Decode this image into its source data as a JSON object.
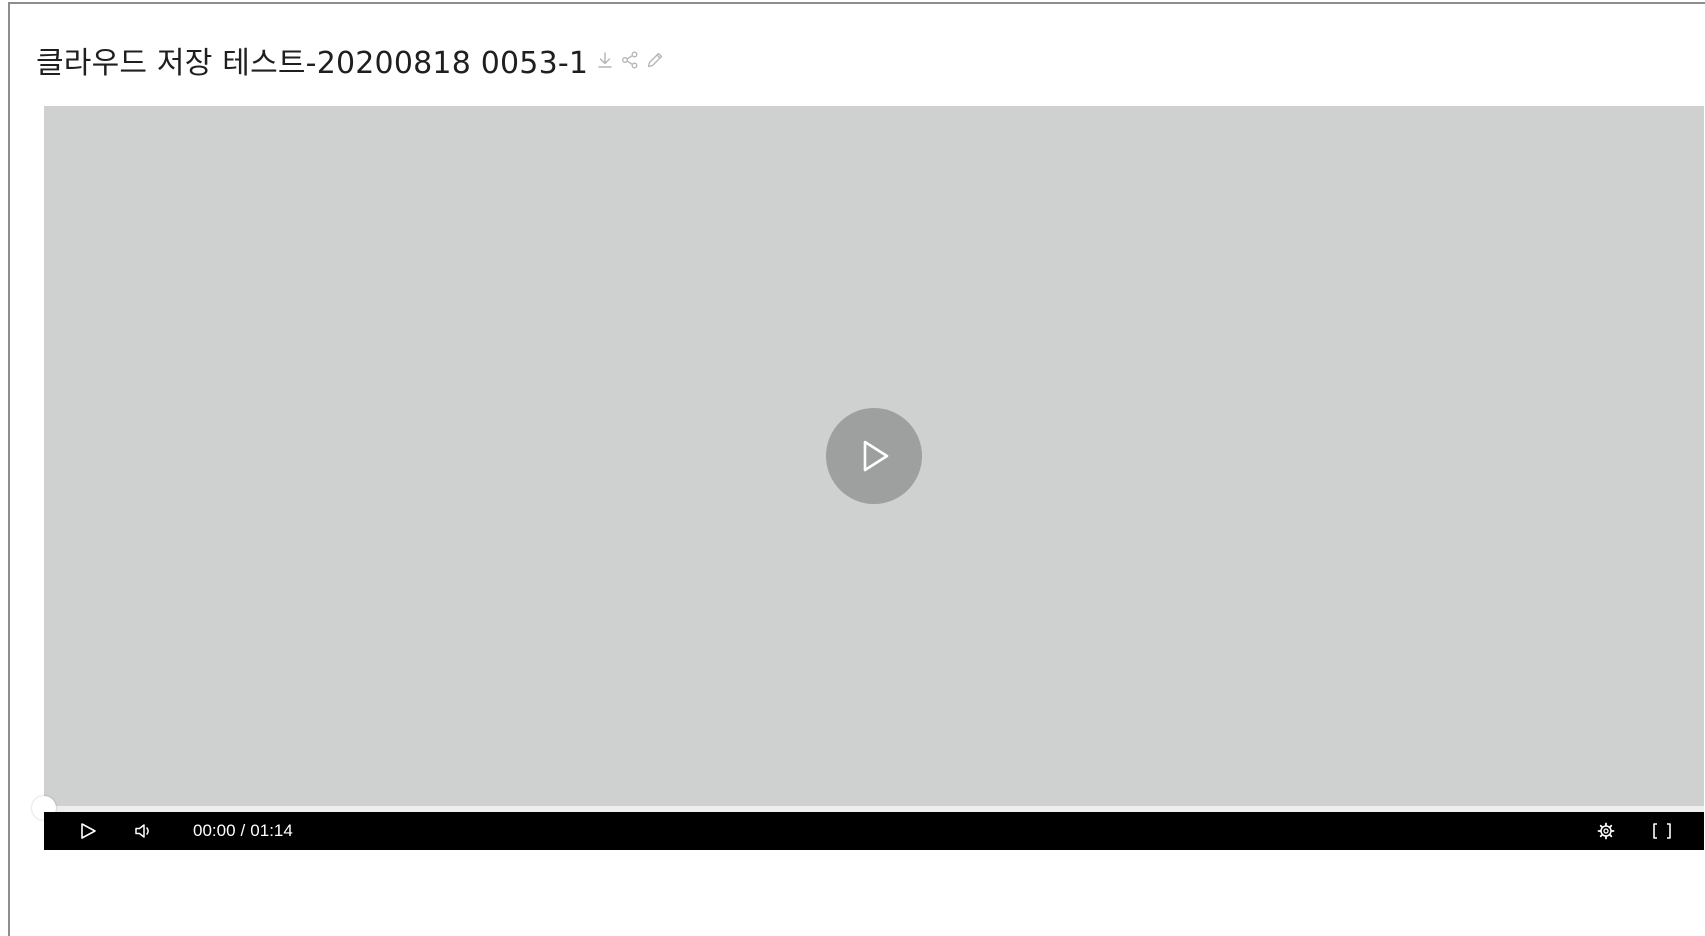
{
  "video": {
    "title": "클라우드 저장 테스트-20200818 0053-1",
    "current_time": "00:00",
    "separator": "/",
    "duration": "01:14",
    "progress_fraction": 0
  },
  "title_actions": [
    {
      "icon": "download-icon"
    },
    {
      "icon": "share-icon"
    },
    {
      "icon": "edit-pencil-icon"
    }
  ],
  "controls": {
    "left": [
      "play-icon",
      "volume-icon"
    ],
    "right": [
      "settings-gear-icon",
      "fullscreen-icon"
    ]
  },
  "colors": {
    "player_background": "#cfd1d0",
    "big_play_button": "#9e9f9f",
    "control_bar": "#000000",
    "title_icons": "#b4b4b4"
  }
}
